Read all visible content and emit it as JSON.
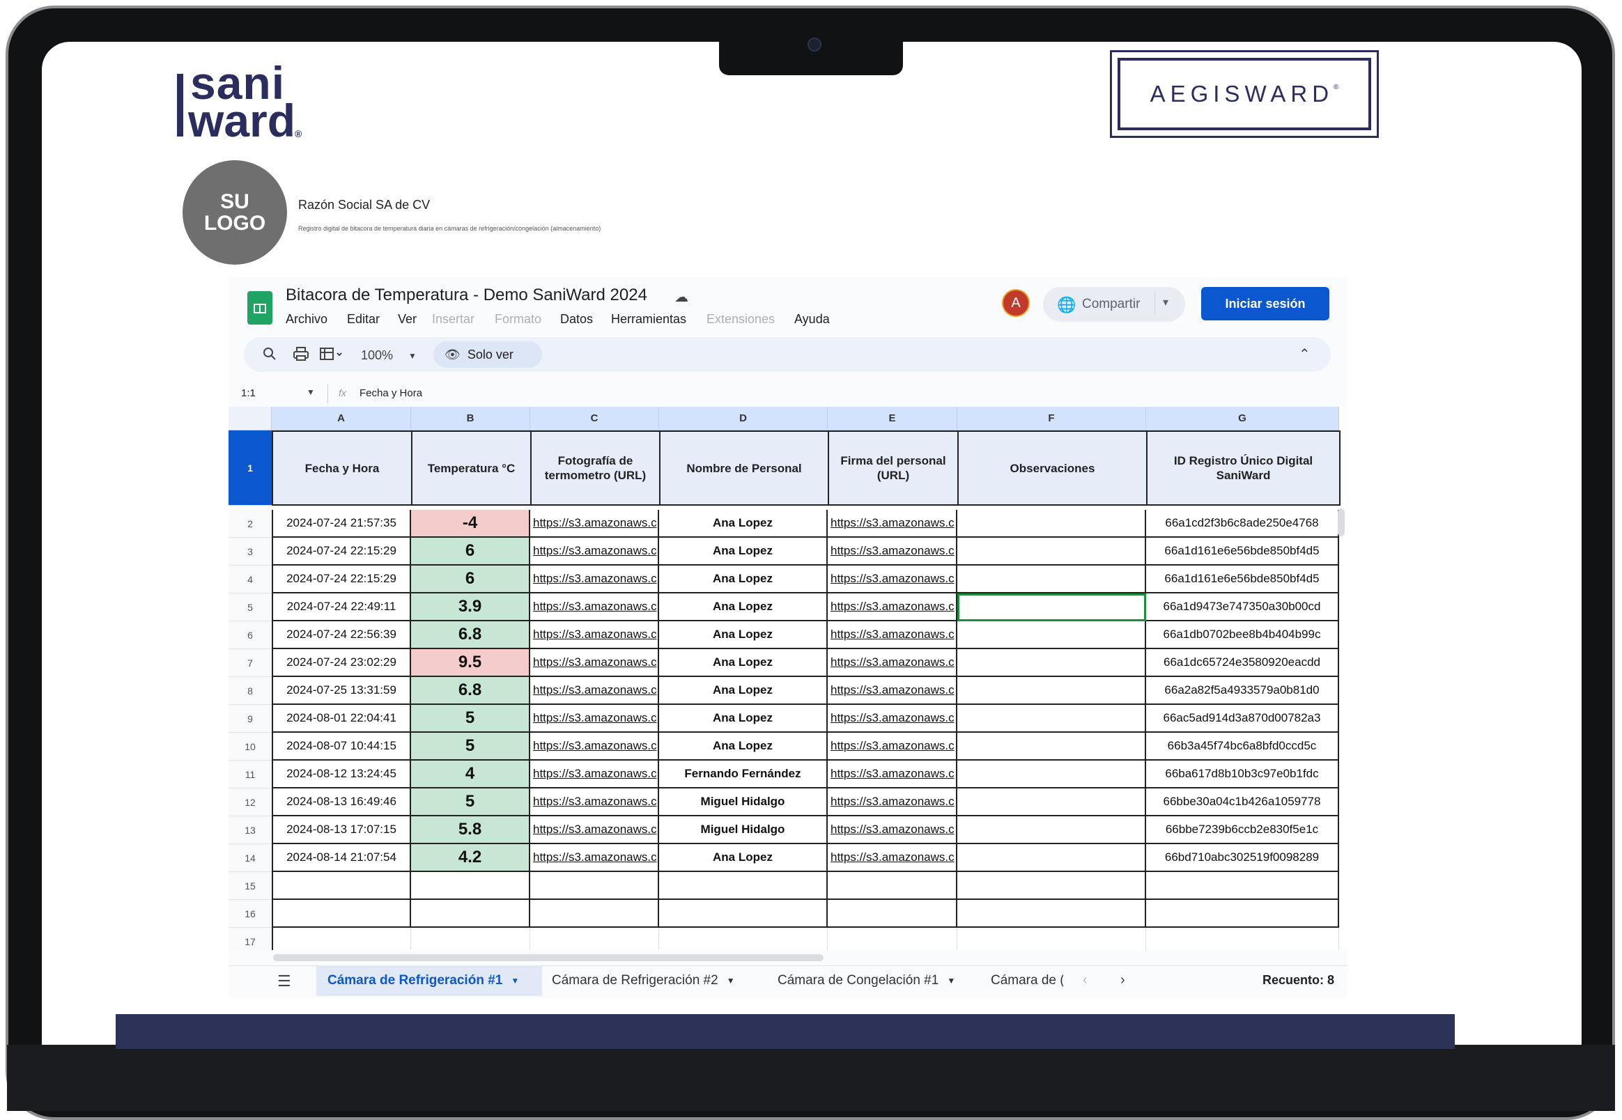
{
  "brand": {
    "saniward_line1": "sani",
    "saniward_line2": "ward",
    "saniward_mark": "®",
    "aegisward": "AEGISWARD",
    "aegis_mark": "®",
    "placeholder_logo_line1": "SU",
    "placeholder_logo_line2": "LOGO",
    "company_name": "Razón Social SA de CV",
    "subtitle": "Registro digital de bitacora de temperatura diaria en cámaras de refrigeración/congelación (almacenamiento)"
  },
  "sheets": {
    "title": "Bitacora de Temperatura - Demo SaniWard 2024",
    "menu": [
      {
        "label": "Archivo",
        "enabled": true
      },
      {
        "label": "Editar",
        "enabled": true
      },
      {
        "label": "Ver",
        "enabled": true
      },
      {
        "label": "Insertar",
        "enabled": false
      },
      {
        "label": "Formato",
        "enabled": false
      },
      {
        "label": "Datos",
        "enabled": true
      },
      {
        "label": "Herramientas",
        "enabled": true
      },
      {
        "label": "Extensiones",
        "enabled": false
      },
      {
        "label": "Ayuda",
        "enabled": true
      }
    ],
    "avatar_letter": "A",
    "share_label": "Compartir",
    "signin_label": "Iniciar sesión",
    "zoom": "100%",
    "view_only_label": "Solo ver",
    "name_box": "1:1",
    "formula_value": "Fecha y Hora",
    "column_letters": [
      "A",
      "B",
      "C",
      "D",
      "E",
      "F",
      "G"
    ],
    "headers": [
      "Fecha y Hora",
      "Temperatura °C",
      "Fotografía de termometro (URL)",
      "Nombre de Personal",
      "Firma del personal (URL)",
      "Observaciones",
      "ID Registro Único Digital SaniWard"
    ],
    "header_row_number": "1",
    "rows": [
      {
        "n": "2",
        "fecha": "2024-07-24 21:57:35",
        "temp": "-4",
        "status": "alert",
        "foto": "https://s3.amazonaws.c",
        "nombre": "Ana Lopez",
        "firma": "https://s3.amazonaws.c",
        "obs": "",
        "id": "66a1cd2f3b6c8ade250e4768"
      },
      {
        "n": "3",
        "fecha": "2024-07-24 22:15:29",
        "temp": "6",
        "status": "ok",
        "foto": "https://s3.amazonaws.c",
        "nombre": "Ana Lopez",
        "firma": "https://s3.amazonaws.c",
        "obs": "",
        "id": "66a1d161e6e56bde850bf4d5"
      },
      {
        "n": "4",
        "fecha": "2024-07-24 22:15:29",
        "temp": "6",
        "status": "ok",
        "foto": "https://s3.amazonaws.c",
        "nombre": "Ana Lopez",
        "firma": "https://s3.amazonaws.c",
        "obs": "",
        "id": "66a1d161e6e56bde850bf4d5"
      },
      {
        "n": "5",
        "fecha": "2024-07-24 22:49:11",
        "temp": "3.9",
        "status": "ok",
        "foto": "https://s3.amazonaws.c",
        "nombre": "Ana Lopez",
        "firma": "https://s3.amazonaws.c",
        "obs": "",
        "id": "66a1d9473e747350a30b00cd"
      },
      {
        "n": "6",
        "fecha": "2024-07-24 22:56:39",
        "temp": "6.8",
        "status": "ok",
        "foto": "https://s3.amazonaws.c",
        "nombre": "Ana Lopez",
        "firma": "https://s3.amazonaws.c",
        "obs": "",
        "id": "66a1db0702bee8b4b404b99c"
      },
      {
        "n": "7",
        "fecha": "2024-07-24 23:02:29",
        "temp": "9.5",
        "status": "alert",
        "foto": "https://s3.amazonaws.c",
        "nombre": "Ana Lopez",
        "firma": "https://s3.amazonaws.c",
        "obs": "",
        "id": "66a1dc65724e3580920eacdd"
      },
      {
        "n": "8",
        "fecha": "2024-07-25 13:31:59",
        "temp": "6.8",
        "status": "ok",
        "foto": "https://s3.amazonaws.c",
        "nombre": "Ana Lopez",
        "firma": "https://s3.amazonaws.c",
        "obs": "",
        "id": "66a2a82f5a4933579a0b81d0"
      },
      {
        "n": "9",
        "fecha": "2024-08-01 22:04:41",
        "temp": "5",
        "status": "ok",
        "foto": "https://s3.amazonaws.c",
        "nombre": "Ana Lopez",
        "firma": "https://s3.amazonaws.c",
        "obs": "",
        "id": "66ac5ad914d3a870d00782a3"
      },
      {
        "n": "10",
        "fecha": "2024-08-07 10:44:15",
        "temp": "5",
        "status": "ok",
        "foto": "https://s3.amazonaws.c",
        "nombre": "Ana Lopez",
        "firma": "https://s3.amazonaws.c",
        "obs": "",
        "id": "66b3a45f74bc6a8bfd0ccd5c"
      },
      {
        "n": "11",
        "fecha": "2024-08-12 13:24:45",
        "temp": "4",
        "status": "ok",
        "foto": "https://s3.amazonaws.c",
        "nombre": "Fernando Fernández",
        "firma": "https://s3.amazonaws.c",
        "obs": "",
        "id": "66ba617d8b10b3c97e0b1fdc"
      },
      {
        "n": "12",
        "fecha": "2024-08-13 16:49:46",
        "temp": "5",
        "status": "ok",
        "foto": "https://s3.amazonaws.c",
        "nombre": "Miguel Hidalgo",
        "firma": "https://s3.amazonaws.c",
        "obs": "",
        "id": "66bbe30a04c1b426a1059778"
      },
      {
        "n": "13",
        "fecha": "2024-08-13 17:07:15",
        "temp": "5.8",
        "status": "ok",
        "foto": "https://s3.amazonaws.c",
        "nombre": "Miguel Hidalgo",
        "firma": "https://s3.amazonaws.c",
        "obs": "",
        "id": "66bbe7239b6ccb2e830f5e1c"
      },
      {
        "n": "14",
        "fecha": "2024-08-14 21:07:54",
        "temp": "4.2",
        "status": "ok",
        "foto": "https://s3.amazonaws.c",
        "nombre": "Ana Lopez",
        "firma": "https://s3.amazonaws.c",
        "obs": "",
        "id": "66bd710abc302519f0098289"
      }
    ],
    "empty_rows": [
      "15",
      "16",
      "17"
    ],
    "selected_cell": {
      "row": "5",
      "col": "F"
    },
    "tabs": [
      {
        "label": "Cámara de Refrigeración #1",
        "active": true
      },
      {
        "label": "Cámara de Refrigeración #2",
        "active": false
      },
      {
        "label": "Cámara de Congelación #1",
        "active": false
      },
      {
        "label": "Cámara de (",
        "active": false
      }
    ],
    "status_summary": "Recuento: 8"
  },
  "colors": {
    "alert_fill": "#f4cccc",
    "ok_fill": "#c8e6d4",
    "accent": "#0b57d0",
    "brand_navy": "#2b2d5e"
  },
  "icons": {
    "sheets": "sheets-logo-icon",
    "cloud": "cloud-icon",
    "search": "search-icon",
    "print": "print-icon",
    "format": "paint-format-icon",
    "eye": "eye-icon",
    "globe": "globe-icon",
    "collapse": "chevron-up-icon",
    "function": "fx-icon",
    "all_sheets": "hamburger-icon"
  }
}
